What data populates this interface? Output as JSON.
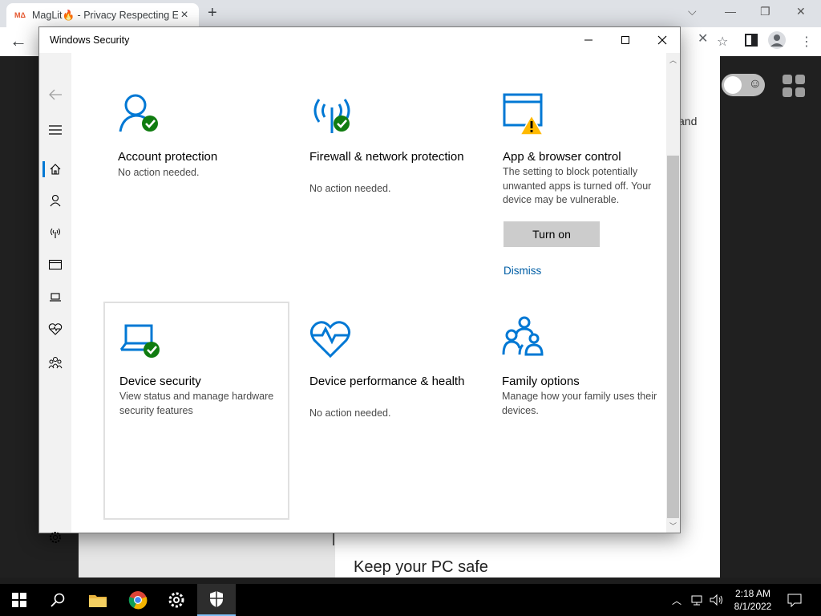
{
  "browser": {
    "tab_title": "MagLit🔥 - Privacy Respecting Er",
    "tab_favicon": "MΔ",
    "page_right_text": "and",
    "keep_safe_text": "Keep your PC safe"
  },
  "window": {
    "title": "Windows Security",
    "minimize_label": "—",
    "maximize_label": "☐",
    "close_label": "✕"
  },
  "tiles": [
    {
      "title": "Account protection",
      "desc": "No action needed.",
      "icon": "account-protection-icon",
      "status": "ok"
    },
    {
      "title": "Firewall & network protection",
      "desc": "No action needed.",
      "icon": "firewall-network-icon",
      "status": "ok"
    },
    {
      "title": "App & browser control",
      "desc": "The setting to block potentially unwanted apps is turned off. Your device may be vulnerable.",
      "icon": "app-browser-control-icon",
      "status": "warning",
      "button": "Turn on",
      "link": "Dismiss"
    },
    {
      "title": "Device security",
      "desc": "View status and manage hardware security features",
      "icon": "device-security-icon",
      "status": "ok"
    },
    {
      "title": "Device performance & health",
      "desc": "No action needed.",
      "icon": "device-performance-icon",
      "status": "ok"
    },
    {
      "title": "Family options",
      "desc": "Manage how your family uses their devices.",
      "icon": "family-options-icon",
      "status": "none"
    }
  ],
  "taskbar": {
    "time": "2:18 AM",
    "date": "8/1/2022"
  },
  "colors": {
    "accent": "#0078d4",
    "ok_green": "#107c10",
    "warning_yellow": "#ffb900",
    "link_blue": "#005ea5"
  }
}
